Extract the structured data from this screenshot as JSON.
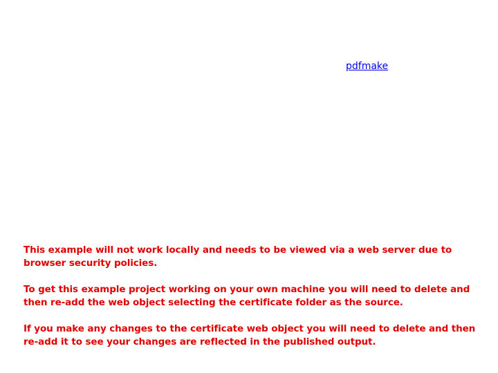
{
  "link": {
    "label": "pdfmake"
  },
  "notice": {
    "paragraphs": [
      "This example will not work locally and needs to be viewed via a web server due to browser security policies.",
      "To get this example project working on your own machine you will need to delete and then re-add the web object selecting the certificate folder as the source.",
      "If you make any changes to the certificate web object you will need to delete and then re-add it to see your changes are reflected in the published output."
    ],
    "color": "#e00000"
  },
  "colors": {
    "link": "#0000ee",
    "background": "#ffffff"
  }
}
